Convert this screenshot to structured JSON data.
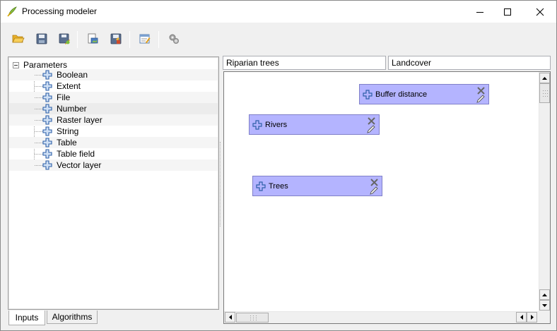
{
  "window": {
    "title": "Processing modeler",
    "controls": [
      "minimize",
      "maximize",
      "close"
    ]
  },
  "toolbar": {
    "buttons": [
      "open-model",
      "save-model",
      "save-model-as",
      "export-as-image",
      "export-as-python",
      "edit-model-help",
      "run-model"
    ]
  },
  "inputs_panel": {
    "root_label": "Parameters",
    "items": [
      {
        "label": "Boolean"
      },
      {
        "label": "Extent"
      },
      {
        "label": "File"
      },
      {
        "label": "Number"
      },
      {
        "label": "Raster layer"
      },
      {
        "label": "String"
      },
      {
        "label": "Table"
      },
      {
        "label": "Table field"
      },
      {
        "label": "Vector layer"
      }
    ]
  },
  "tabs": {
    "inputs": "Inputs",
    "algorithms": "Algorithms"
  },
  "model": {
    "name": "Riparian trees",
    "group": "Landcover"
  },
  "canvas": {
    "nodes": [
      {
        "label": "Buffer distance"
      },
      {
        "label": "Rivers"
      },
      {
        "label": "Trees"
      }
    ]
  },
  "colors": {
    "node_fill": "#b4b4ff",
    "node_border": "#8080c8",
    "plus_icon": "#3a78c8"
  }
}
